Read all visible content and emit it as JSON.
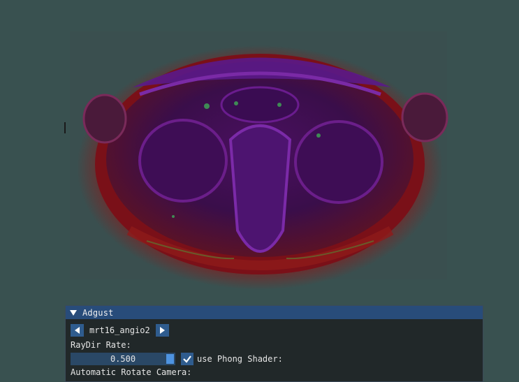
{
  "scene": {
    "background_color": "#395150",
    "render_description_icon": "volume-render"
  },
  "panel": {
    "title": "Adgust",
    "header_color": "#284c7a",
    "collapse_icon": "triangle-down-icon",
    "dataset": {
      "prev_icon": "arrow-left-icon",
      "next_icon": "arrow-right-icon",
      "name": "mrt16_angio2"
    },
    "raydir": {
      "label": "RayDir Rate:",
      "value": "0.500",
      "fraction": 0.5
    },
    "phong": {
      "label": "use Phong Shader:",
      "checked": true,
      "check_icon": "checkmark-icon"
    },
    "autorotate": {
      "label": "Automatic Rotate Camera:"
    },
    "accent_color": "#4e93e0"
  }
}
